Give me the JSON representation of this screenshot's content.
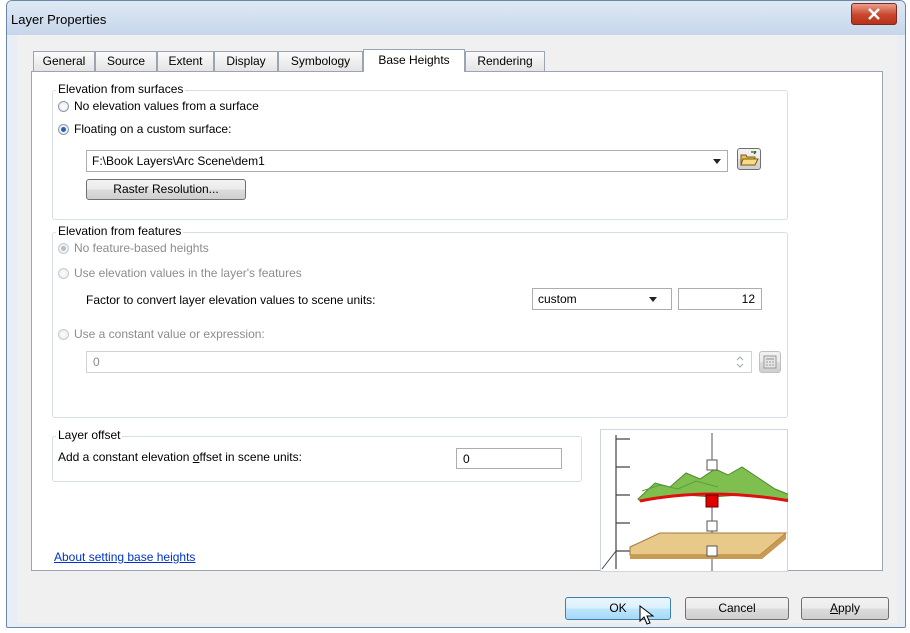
{
  "window": {
    "title": "Layer Properties"
  },
  "tabs": [
    "General",
    "Source",
    "Extent",
    "Display",
    "Symbology",
    "Base Heights",
    "Rendering"
  ],
  "active_tab": "Base Heights",
  "surfaces": {
    "legend": "Elevation from surfaces",
    "option_none": "No elevation values from a surface",
    "option_floating": "Floating on a custom surface:",
    "selected": "floating",
    "surface_path": "F:\\Book Layers\\Arc Scene\\dem1",
    "raster_button": "Raster Resolution..."
  },
  "features": {
    "legend": "Elevation from features",
    "option_none": "No feature-based heights",
    "option_layer_values": "Use elevation values in the layer's features",
    "factor_label": "Factor to convert layer elevation values to scene units:",
    "unit_combo": "custom",
    "factor_value": "12",
    "option_constant": "Use a constant value or expression:",
    "expression_value": "0"
  },
  "offset": {
    "legend": "Layer offset",
    "label_before": "Add a constant elevation ",
    "label_mnemonic": "o",
    "label_after": "ffset in scene units:",
    "value": "0"
  },
  "help_link": "About setting base heights",
  "buttons": {
    "ok": "OK",
    "cancel": "Cancel",
    "apply_mnemonic": "A",
    "apply_rest": "pply"
  }
}
